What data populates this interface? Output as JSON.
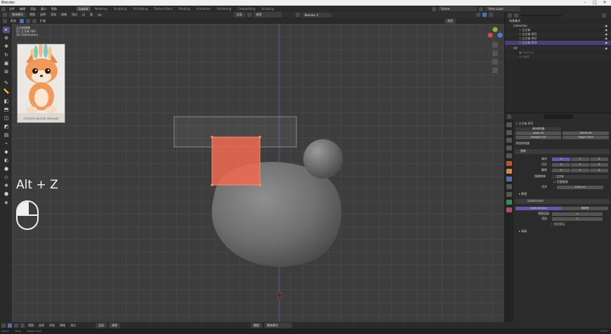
{
  "window": {
    "title": "Blender",
    "minimize": "–",
    "maximize": "□",
    "close": "✕"
  },
  "menubar": {
    "items": [
      "文件",
      "编辑",
      "渲染",
      "窗口",
      "帮助"
    ]
  },
  "workspaces": {
    "tabs": [
      "Layout",
      "Modeling",
      "Sculpting",
      "UV Editing",
      "Texture Paint",
      "Shading",
      "Animation",
      "Rendering",
      "Compositing",
      "Scripting"
    ],
    "active": "Layout"
  },
  "scene": {
    "label": "Scene",
    "view_layer": "View Layer"
  },
  "viewport_header": {
    "mode": "物体模式",
    "menus": [
      "视图",
      "选择",
      "添加",
      "网格",
      "顶点",
      "边",
      "面",
      "UV"
    ],
    "transform": "全局",
    "snap": "吸附",
    "proportional": "Blender 4"
  },
  "tool_header": {
    "options": "选项",
    "selection": "框选",
    "extend": "扩展"
  },
  "overlay": {
    "view": "正交前视图",
    "collection": "(1) 立方体.003",
    "units": "10 Centimeters"
  },
  "reference_image": {
    "caption": "CUTE BIG FACE BY SHENMEI"
  },
  "shortcut": {
    "text": "Alt + Z"
  },
  "outliner": {
    "title": "场景集合",
    "search_placeholder": "",
    "rows": [
      {
        "label": "场景集合",
        "level": 0
      },
      {
        "label": "Collection",
        "level": 1
      },
      {
        "label": "立方体",
        "level": 2
      },
      {
        "label": "立方体.001",
        "level": 2
      },
      {
        "label": "立方体.002",
        "level": 2
      },
      {
        "label": "立方体.003",
        "level": 2,
        "selected": true
      },
      {
        "label": "UV",
        "level": 1
      },
      {
        "label": "Camera",
        "level": 2
      },
      {
        "label": "Light",
        "level": 2
      }
    ]
  },
  "properties": {
    "object": "立方体.003",
    "add_modifier": "添加修改器",
    "apply_all": "Apply All",
    "delete_all": "Delete All",
    "viewport_vis": "Viewport Vis",
    "toggle_stack": "Toggle Stack",
    "mirror": {
      "name": "镜像",
      "axis_label": "轴向",
      "bisect_label": "切分",
      "flip_label": "翻转",
      "x": "X",
      "y": "Y",
      "z": "Z",
      "object_label": "镜像物体",
      "object_value": "立方体",
      "clipping_label": "范围限制",
      "merge_label": "合并",
      "merge_value": "0.001 m",
      "data_label": "数据"
    },
    "subdiv": {
      "name": "Subdivision",
      "catmull": "Catmull-Clark",
      "simple": "简单型",
      "levels_label": "视图层级",
      "render_label": "渲染",
      "levels_value": "2",
      "render_value": "2",
      "optimal_label": "优化显示",
      "advanced_label": "高级"
    }
  },
  "statusbar": {
    "mode": "物体模式",
    "shading": "全局",
    "pivot": "清除",
    "item_menus": [
      "视图",
      "选择",
      "添加",
      "网格",
      "顶点"
    ],
    "zoom": "缩放"
  },
  "infobar": {
    "select": "Select",
    "move": "Move",
    "rotate": "Rotate View",
    "version": "2.93.4"
  },
  "colors": {
    "accent": "#4772b3",
    "select": "#ff6a4a",
    "purple": "#6856a8"
  }
}
